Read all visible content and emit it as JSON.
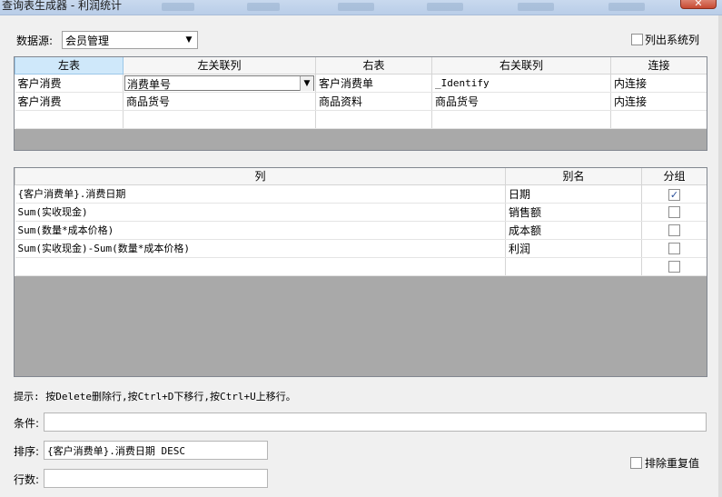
{
  "window": {
    "title": "查询表生成器 - 利润统计",
    "close_label": "✕"
  },
  "datasource": {
    "label": "数据源:",
    "value": "会员管理"
  },
  "list_system_columns": {
    "label": "列出系统列",
    "checked": false
  },
  "joins": {
    "headers": [
      "左表",
      "左关联列",
      "右表",
      "右关联列",
      "连接"
    ],
    "rows": [
      [
        "客户消费",
        "消费单号",
        "客户消费单",
        "_Identify",
        "内连接"
      ],
      [
        "客户消费",
        "商品货号",
        "商品资料",
        "商品货号",
        "内连接"
      ],
      [
        "",
        "",
        "",
        "",
        ""
      ]
    ]
  },
  "columns": {
    "headers": [
      "列",
      "别名",
      "分组"
    ],
    "rows": [
      {
        "expr": "{客户消费单}.消费日期",
        "alias": "日期",
        "group": true
      },
      {
        "expr": "Sum(实收现金)",
        "alias": "销售额",
        "group": false
      },
      {
        "expr": "Sum(数量*成本价格)",
        "alias": "成本额",
        "group": false
      },
      {
        "expr": "Sum(实收现金)-Sum(数量*成本价格)",
        "alias": "利润",
        "group": false
      },
      {
        "expr": "",
        "alias": "",
        "group": false
      }
    ]
  },
  "hint": "提示: 按Delete删除行,按Ctrl+D下移行,按Ctrl+U上移行。",
  "condition": {
    "label": "条件:",
    "value": ""
  },
  "sort": {
    "label": "排序:",
    "value": "{客户消费单}.消费日期 DESC"
  },
  "rowcount": {
    "label": "行数:",
    "value": ""
  },
  "distinct": {
    "label": "排除重复值",
    "checked": false
  },
  "icons": {
    "dropdown": "chevron-down-icon",
    "check": "checkmark-icon"
  }
}
